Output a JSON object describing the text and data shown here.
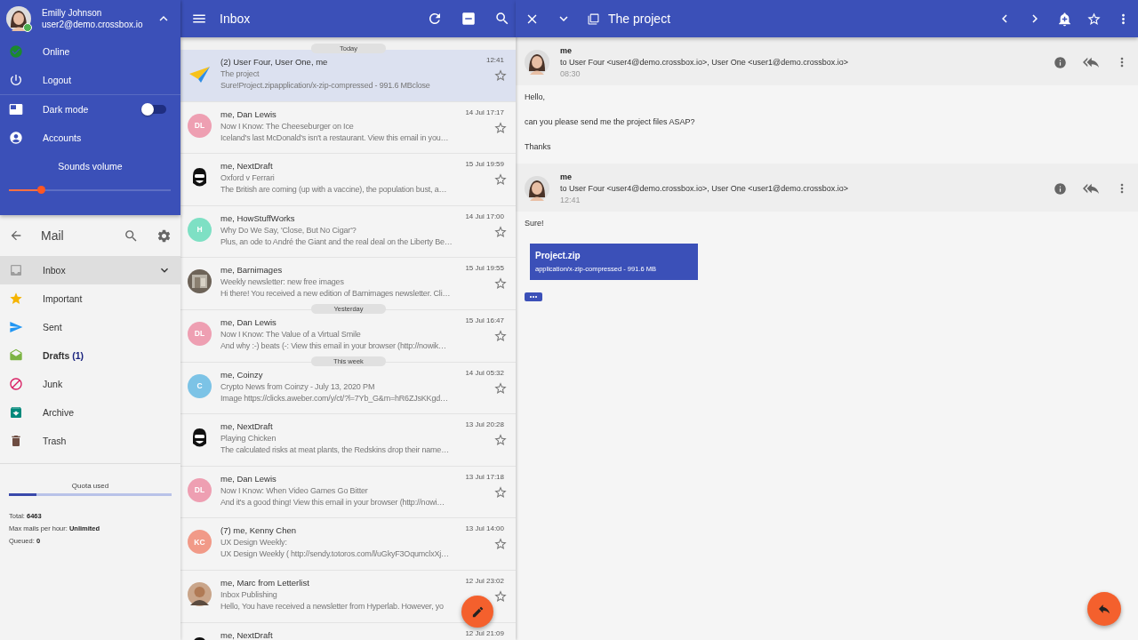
{
  "account": {
    "name": "Emilly Johnson",
    "email": "user2@demo.crossbox.io",
    "online": true,
    "menu_expanded": true
  },
  "account_menu": [
    {
      "kind": "status",
      "label": "Online"
    },
    {
      "kind": "logout",
      "label": "Logout"
    },
    {
      "kind": "toggle",
      "label": "Dark mode",
      "on": false
    },
    {
      "kind": "accounts",
      "label": "Accounts"
    }
  ],
  "volume": {
    "label": "Sounds volume",
    "level": 0.2
  },
  "mail_header": {
    "title": "Mail"
  },
  "folders": [
    {
      "kind": "inbox",
      "label": "Inbox",
      "selected": true,
      "unread": false,
      "expanded": false
    },
    {
      "kind": "important",
      "label": "Important",
      "selected": false,
      "unread": false
    },
    {
      "kind": "sent",
      "label": "Sent",
      "selected": false,
      "unread": false
    },
    {
      "kind": "drafts",
      "label": "Drafts",
      "count": "(1)",
      "selected": false,
      "unread": true
    },
    {
      "kind": "junk",
      "label": "Junk",
      "selected": false,
      "unread": false
    },
    {
      "kind": "archive",
      "label": "Archive",
      "selected": false,
      "unread": false
    },
    {
      "kind": "trash",
      "label": "Trash",
      "selected": false,
      "unread": false
    }
  ],
  "quota": {
    "label": "Quota used",
    "level": 0.17,
    "stats": [
      {
        "label": "Total:",
        "value": "6463"
      },
      {
        "label": "Max mails per hour:",
        "value": "Unlimited"
      },
      {
        "label": "Queued:",
        "value": "0"
      }
    ]
  },
  "inbox": {
    "title": "Inbox",
    "messages": [
      {
        "section": "Today",
        "senders": "(2) User Four, User One, me",
        "subject": "The project",
        "preview": "Sure!Project.zipapplication/x-zip-compressed - 991.6 MBclose",
        "time": "12:41",
        "avatar": {
          "kind": "logo"
        },
        "selected": true,
        "starred": false
      },
      {
        "senders": "me, Dan Lewis",
        "subject": "Now I Know: The Cheeseburger on Ice",
        "preview": "Iceland's last McDonald's isn't a restaurant. View this email in you…",
        "time": "14 Jul 17:17",
        "avatar": {
          "kind": "initials",
          "text": "DL",
          "color": "#ee9fb2"
        },
        "selected": false,
        "starred": false
      },
      {
        "senders": "me, NextDraft",
        "subject": "Oxford v Ferrari",
        "preview": "The British are coming (up with a vaccine), the population bust, a…",
        "time": "15 Jul 19:59",
        "avatar": {
          "kind": "mascot"
        },
        "selected": false,
        "starred": false
      },
      {
        "senders": "me, HowStuffWorks",
        "subject": "Why Do We Say, 'Close, But No Cigar'?",
        "preview": "Plus, an ode to André the Giant and the real deal on the Liberty Be…",
        "time": "14 Jul 17:00",
        "avatar": {
          "kind": "initials",
          "text": "H",
          "color": "#7ee0c4"
        },
        "selected": false,
        "starred": false
      },
      {
        "senders": "me, Barnimages",
        "subject": "Weekly newsletter: new free images",
        "preview": "Hi there! You received a new edition of Barnimages newsletter. Cli…",
        "time": "15 Jul 19:55",
        "selected": false,
        "starred": false
      },
      {
        "section": "Yesterday",
        "senders": "me, Dan Lewis",
        "subject": "Now I Know: The Value of a Virtual Smile",
        "preview": "And why :-) beats (-:  View this email in your browser (http://nowik…",
        "time": "15 Jul 16:47",
        "avatar": {
          "kind": "initials",
          "text": "DL",
          "color": "#ee9fb2"
        },
        "selected": false,
        "starred": false
      },
      {
        "section": "This week",
        "senders": "me, Coinzy",
        "subject": "Crypto News from Coinzy - July 13, 2020 PM",
        "preview": "Image https://clicks.aweber.com/y/ct/?l=7Yb_G&m=hR6ZJsKKgd…",
        "time": "14 Jul 05:32",
        "avatar": {
          "kind": "initials",
          "text": "C",
          "color": "#7cc3e6"
        },
        "selected": false,
        "starred": false
      },
      {
        "senders": "me, NextDraft",
        "subject": "Playing Chicken",
        "preview": "The calculated risks at meat plants, the Redskins drop their name…",
        "time": "13 Jul 20:28",
        "avatar": {
          "kind": "mascot"
        },
        "selected": false,
        "starred": false
      },
      {
        "senders": "me, Dan Lewis",
        "subject": "Now I Know: When Video Games Go Bitter",
        "preview": "And it's a good thing! View this email in your browser (http://nowi…",
        "time": "13 Jul 17:18",
        "avatar": {
          "kind": "initials",
          "text": "DL",
          "color": "#ee9fb2"
        },
        "selected": false,
        "starred": false
      },
      {
        "senders": "(7) me, Kenny Chen",
        "subject": "UX Design Weekly:",
        "preview": "UX Design Weekly ( http://sendy.totoros.com/l/uGkyF3OqumclxXj…",
        "time": "13 Jul 14:00",
        "avatar": {
          "kind": "initials",
          "text": "KC",
          "color": "#f19a88"
        },
        "selected": false,
        "starred": false
      },
      {
        "senders": "me, Marc from Letterlist",
        "subject": "Inbox Publishing",
        "preview": "Hello, You have received a newsletter from Hyperlab. However, yo",
        "time": "12 Jul 23:02",
        "avatar": {
          "kind": "person"
        },
        "selected": false,
        "starred": false
      },
      {
        "senders": "me, NextDraft",
        "time": "12 Jul 21:09",
        "avatar": {
          "kind": "mascot"
        },
        "selected": false
      }
    ]
  },
  "thread": {
    "title": "The project",
    "messages": [
      {
        "from": "me",
        "to": "to User Four <user4@demo.crossbox.io>, User One <user1@demo.crossbox.io>",
        "time": "08:30",
        "paragraphs": [
          "Hello,",
          "can you please send me the project files ASAP?",
          "Thanks"
        ]
      },
      {
        "from": "me",
        "to": "to User Four <user4@demo.crossbox.io>, User One <user1@demo.crossbox.io>",
        "time": "12:41",
        "paragraphs": [
          "Sure!"
        ],
        "attachment": {
          "name": "Project.zip",
          "info": "application/x-zip-compressed - 991.6 MB"
        }
      }
    ]
  }
}
